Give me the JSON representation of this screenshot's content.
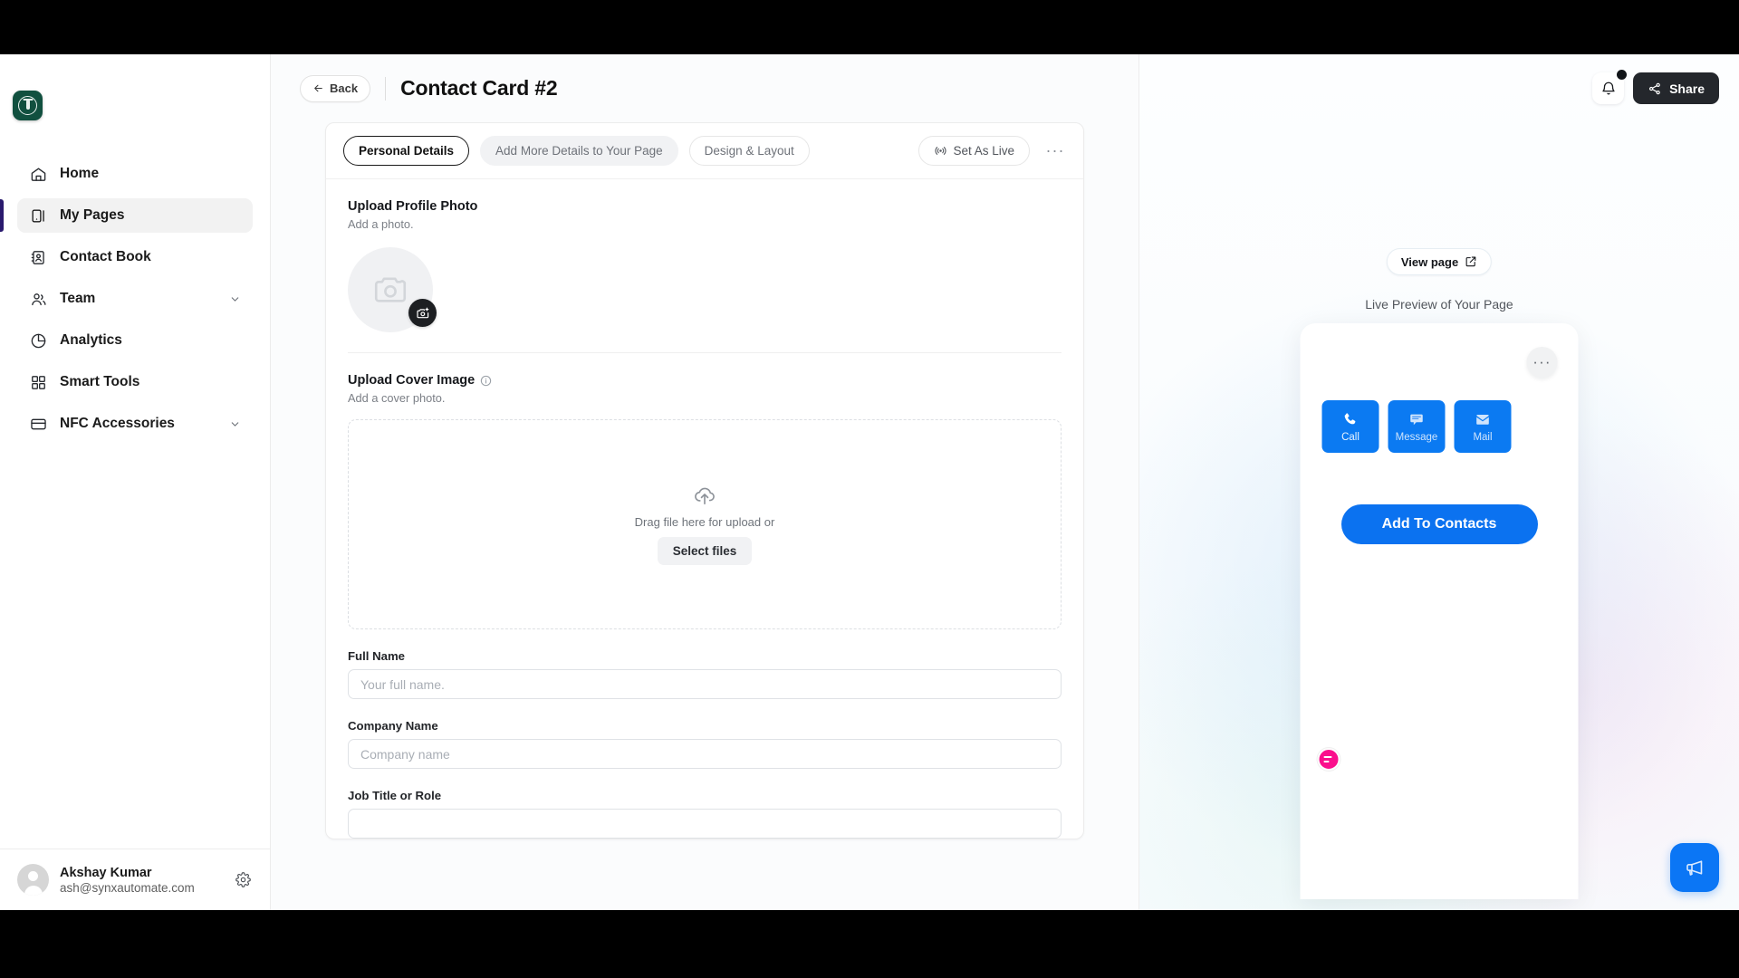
{
  "sidebar": {
    "logo_name": "app-logo",
    "items": [
      {
        "label": "Home",
        "icon": "home-icon",
        "expandable": false
      },
      {
        "label": "My Pages",
        "icon": "pages-icon",
        "expandable": false
      },
      {
        "label": "Contact Book",
        "icon": "contact-book-icon",
        "expandable": false
      },
      {
        "label": "Team",
        "icon": "team-icon",
        "expandable": true
      },
      {
        "label": "Analytics",
        "icon": "analytics-icon",
        "expandable": false
      },
      {
        "label": "Smart Tools",
        "icon": "smart-tools-icon",
        "expandable": false
      },
      {
        "label": "NFC Accessories",
        "icon": "nfc-card-icon",
        "expandable": true
      }
    ],
    "active_item": "My Pages",
    "user": {
      "name": "Akshay Kumar",
      "email": "ash@synxautomate.com",
      "settings_icon": "gear-icon"
    }
  },
  "topbar": {
    "back_label": "Back",
    "title": "Contact Card #2"
  },
  "editor": {
    "tabs": [
      {
        "label": "Personal Details",
        "state": "selected"
      },
      {
        "label": "Add More Details to Your Page",
        "state": "soft"
      },
      {
        "label": "Design & Layout",
        "state": "outline"
      }
    ],
    "set_as_live_label": "Set As Live",
    "overflow_label": "···",
    "profile_photo": {
      "title": "Upload Profile Photo",
      "subtitle": "Add a photo.",
      "placeholder_icon": "camera-icon",
      "upload_icon": "camera-plus-icon"
    },
    "cover_image": {
      "title": "Upload Cover Image",
      "info_icon": "info-icon",
      "subtitle": "Add a cover photo.",
      "drop_text": "Drag file here for upload or",
      "select_button": "Select files",
      "upload_icon": "cloud-upload-icon"
    },
    "fields": [
      {
        "label": "Full Name",
        "value": "",
        "placeholder": "Your full name."
      },
      {
        "label": "Company Name",
        "value": "",
        "placeholder": "Company name"
      },
      {
        "label": "Job Title or Role",
        "value": "",
        "placeholder": ""
      }
    ]
  },
  "preview": {
    "bell_icon": "bell-icon",
    "share_label": "Share",
    "share_icon": "share-icon",
    "view_page_label": "View page",
    "view_page_icon": "external-link-icon",
    "caption": "Live Preview of Your Page",
    "card_menu": "···",
    "actions": [
      {
        "label": "Call",
        "icon": "phone-icon"
      },
      {
        "label": "Message",
        "icon": "message-icon"
      },
      {
        "label": "Mail",
        "icon": "mail-icon"
      }
    ],
    "cta_label": "Add To Contacts",
    "brand_badge_icon": "brand-logo-icon",
    "fab_icon": "megaphone-icon"
  },
  "colors": {
    "accent_blue": "#0b76f5",
    "action_tile": "#0b7af2",
    "brand_pink": "#fa0f8c",
    "logo_green": "#11503f",
    "dark": "#24272c",
    "sidebar_active_bar": "#2a1a6e"
  }
}
